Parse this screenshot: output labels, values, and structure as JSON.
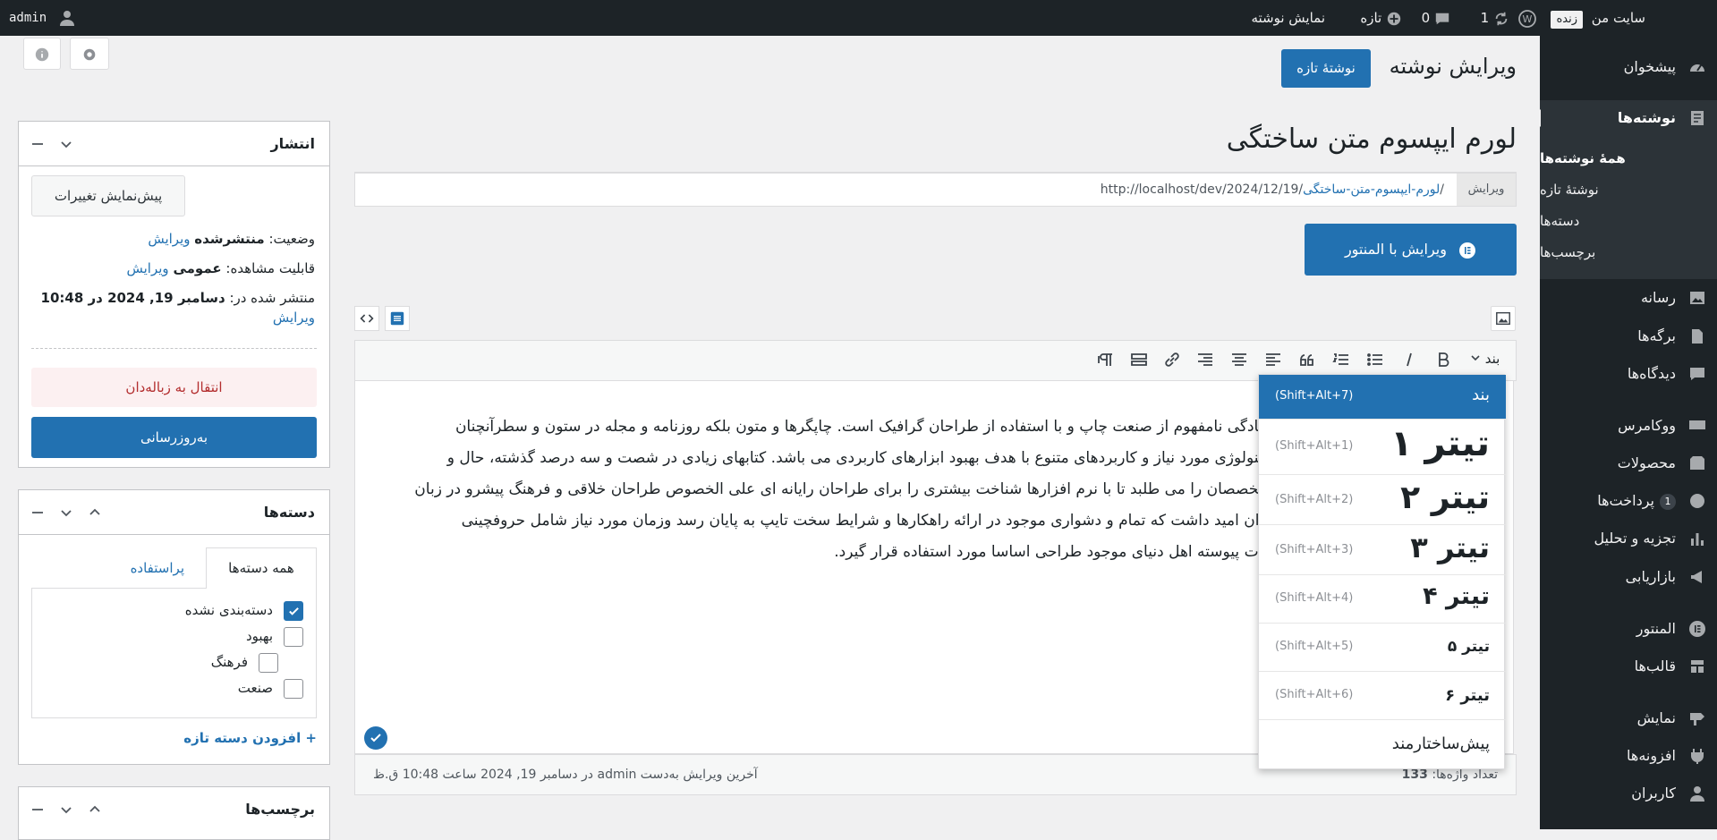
{
  "adminbar": {
    "site_name": "سایت من",
    "live_badge": "زنده",
    "updates_count": "1",
    "comments_count": "0",
    "new_label": "تازه",
    "view_post": "نمایش نوشته",
    "user": "admin"
  },
  "sidebar": {
    "dashboard": "پیشخوان",
    "posts": "نوشته‌ها",
    "posts_sub": [
      "همهٔ نوشته‌ها",
      "نوشتهٔ تازه",
      "دسته‌ها",
      "برچسب‌ها"
    ],
    "media": "رسانه",
    "pages": "برگه‌ها",
    "comments": "دیدگاه‌ها",
    "woocommerce": "ووکامرس",
    "products": "محصولات",
    "payments": "پرداخت‌ها",
    "payments_count": "1",
    "analytics": "تجزیه و تحلیل",
    "marketing": "بازاریابی",
    "elementor": "المنتور",
    "templates": "قالب‌ها",
    "appearance": "نمایش",
    "plugins": "افزونه‌ها",
    "users": "کاربران"
  },
  "header": {
    "page_title": "ویرایش نوشته",
    "new_post_button": "نوشتهٔ تازه"
  },
  "post": {
    "title": "لورم ایپسوم متن ساختگی",
    "permalink_base": "http://localhost/dev/2024/12/19/",
    "permalink_slug": "لورم-ایپسوم-متن-ساختگی",
    "permalink_end": "/",
    "permalink_edit": "ویرایش",
    "elementor_button": "ویرایش با المنتور",
    "paragraph_lines": [
      "سادگی نامفهوم از صنعت چاپ و با استفاده از طراحان گرافیک است. چاپگرها و متون بلکه روزنامه و مجله در ستون و سطرآنچنان",
      "تکنولوژی مورد نیاز و کاربردهای متنوع با هدف بهبود ابزارهای کاربردی می باشد. کتابهای زیادی در شصت و سه درصد گذشته، حال و",
      "متخصصان را می طلبد تا با نرم افزارها شناخت بیشتری را برای طراحان رایانه ای علی الخصوص طراحان خلاقی و فرهنگ پیشرو در زبان",
      "توان امید داشت که تمام و دشواری موجود در ارائه راهکارها و شرایط سخت تایپ به پایان رسد وزمان مورد نیاز شامل حروفچینی",
      "الات پیوسته اهل دنیای موجود طراحی اساسا مورد استفاده قرار گیرد."
    ],
    "word_count_label": "تعداد واژه‌ها:",
    "word_count": "133",
    "last_edit": "آخرین ویرایش به‌دست admin در دسامبر 19, 2024 ساعت 10:48 ق.ظ"
  },
  "toolbar": {
    "format_select": "بند"
  },
  "format_menu": [
    {
      "name": "بند",
      "shortcut": "(Shift+Alt+7)"
    },
    {
      "name": "تیتر ۱",
      "shortcut": "(Shift+Alt+1)"
    },
    {
      "name": "تیتر ۲",
      "shortcut": "(Shift+Alt+2)"
    },
    {
      "name": "تیتر ۳",
      "shortcut": "(Shift+Alt+3)"
    },
    {
      "name": "تیتر ۴",
      "shortcut": "(Shift+Alt+4)"
    },
    {
      "name": "تیتر ۵",
      "shortcut": "(Shift+Alt+5)"
    },
    {
      "name": "تیتر ۶",
      "shortcut": "(Shift+Alt+6)"
    },
    {
      "name": "پیش‌ساختارمند",
      "shortcut": ""
    }
  ],
  "publish": {
    "title": "انتشار",
    "preview_button": "پیش‌نمایش تغییرات",
    "status_label": "وضعیت:",
    "status_value": "منتشرشده",
    "visibility_label": "قابلیت مشاهده:",
    "visibility_value": "عمومی",
    "published_label": "منتشر شده در:",
    "published_value": "دسامبر 19, 2024 در 10:48",
    "edit_link": "ویرایش",
    "trash_button": "انتقال به زباله‌دان",
    "update_button": "به‌روزرسانی"
  },
  "categories": {
    "title": "دسته‌ها",
    "tab_all": "همه دسته‌ها",
    "tab_popular": "پراستفاده",
    "items": [
      "دسته‌بندی نشده",
      "بهبود",
      "فرهنگ",
      "صنعت"
    ],
    "add_new": "+ افزودن دسته تازه"
  },
  "tags": {
    "title": "برچسب‌ها"
  }
}
